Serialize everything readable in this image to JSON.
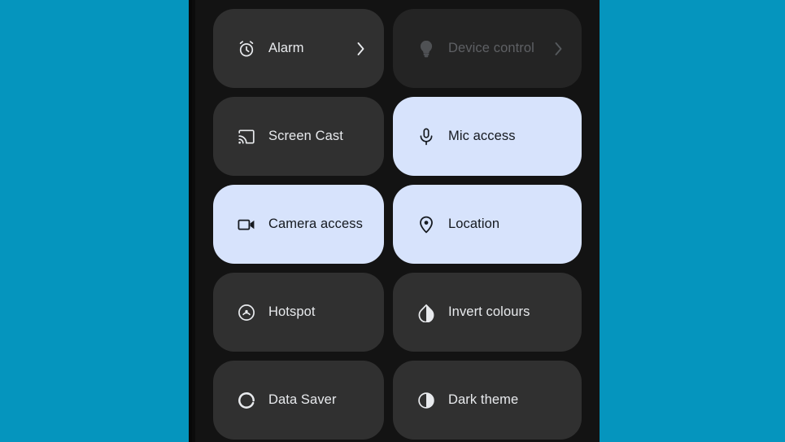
{
  "wallpaper": {
    "background_color": "#0595be"
  },
  "device": {
    "frame_color": "#0b0b0b",
    "panel_background": "#131313"
  },
  "quick_settings": {
    "active_tile_color": "#d7e3fc",
    "inactive_tile_color": "#303030",
    "disabled_tile_color": "#242424",
    "active_label_color": "#15191f",
    "inactive_label_color": "#e8eaed",
    "tiles": [
      {
        "label": "Alarm",
        "icon": "alarm-icon",
        "state": "off",
        "has_chevron": true
      },
      {
        "label": "Device control",
        "icon": "lightbulb-icon",
        "state": "disabled",
        "has_chevron": true
      },
      {
        "label": "Screen Cast",
        "icon": "cast-icon",
        "state": "off",
        "has_chevron": false
      },
      {
        "label": "Mic access",
        "icon": "microphone-icon",
        "state": "on",
        "has_chevron": false
      },
      {
        "label": "Camera access",
        "icon": "video-camera-icon",
        "state": "on",
        "has_chevron": false
      },
      {
        "label": "Location",
        "icon": "location-pin-icon",
        "state": "on",
        "has_chevron": false
      },
      {
        "label": "Hotspot",
        "icon": "hotspot-icon",
        "state": "off",
        "has_chevron": false
      },
      {
        "label": "Invert colours",
        "icon": "invert-colours-icon",
        "state": "off",
        "has_chevron": false
      },
      {
        "label": "Data Saver",
        "icon": "data-saver-icon",
        "state": "off",
        "has_chevron": false
      },
      {
        "label": "Dark theme",
        "icon": "dark-theme-icon",
        "state": "off",
        "has_chevron": false
      }
    ]
  }
}
